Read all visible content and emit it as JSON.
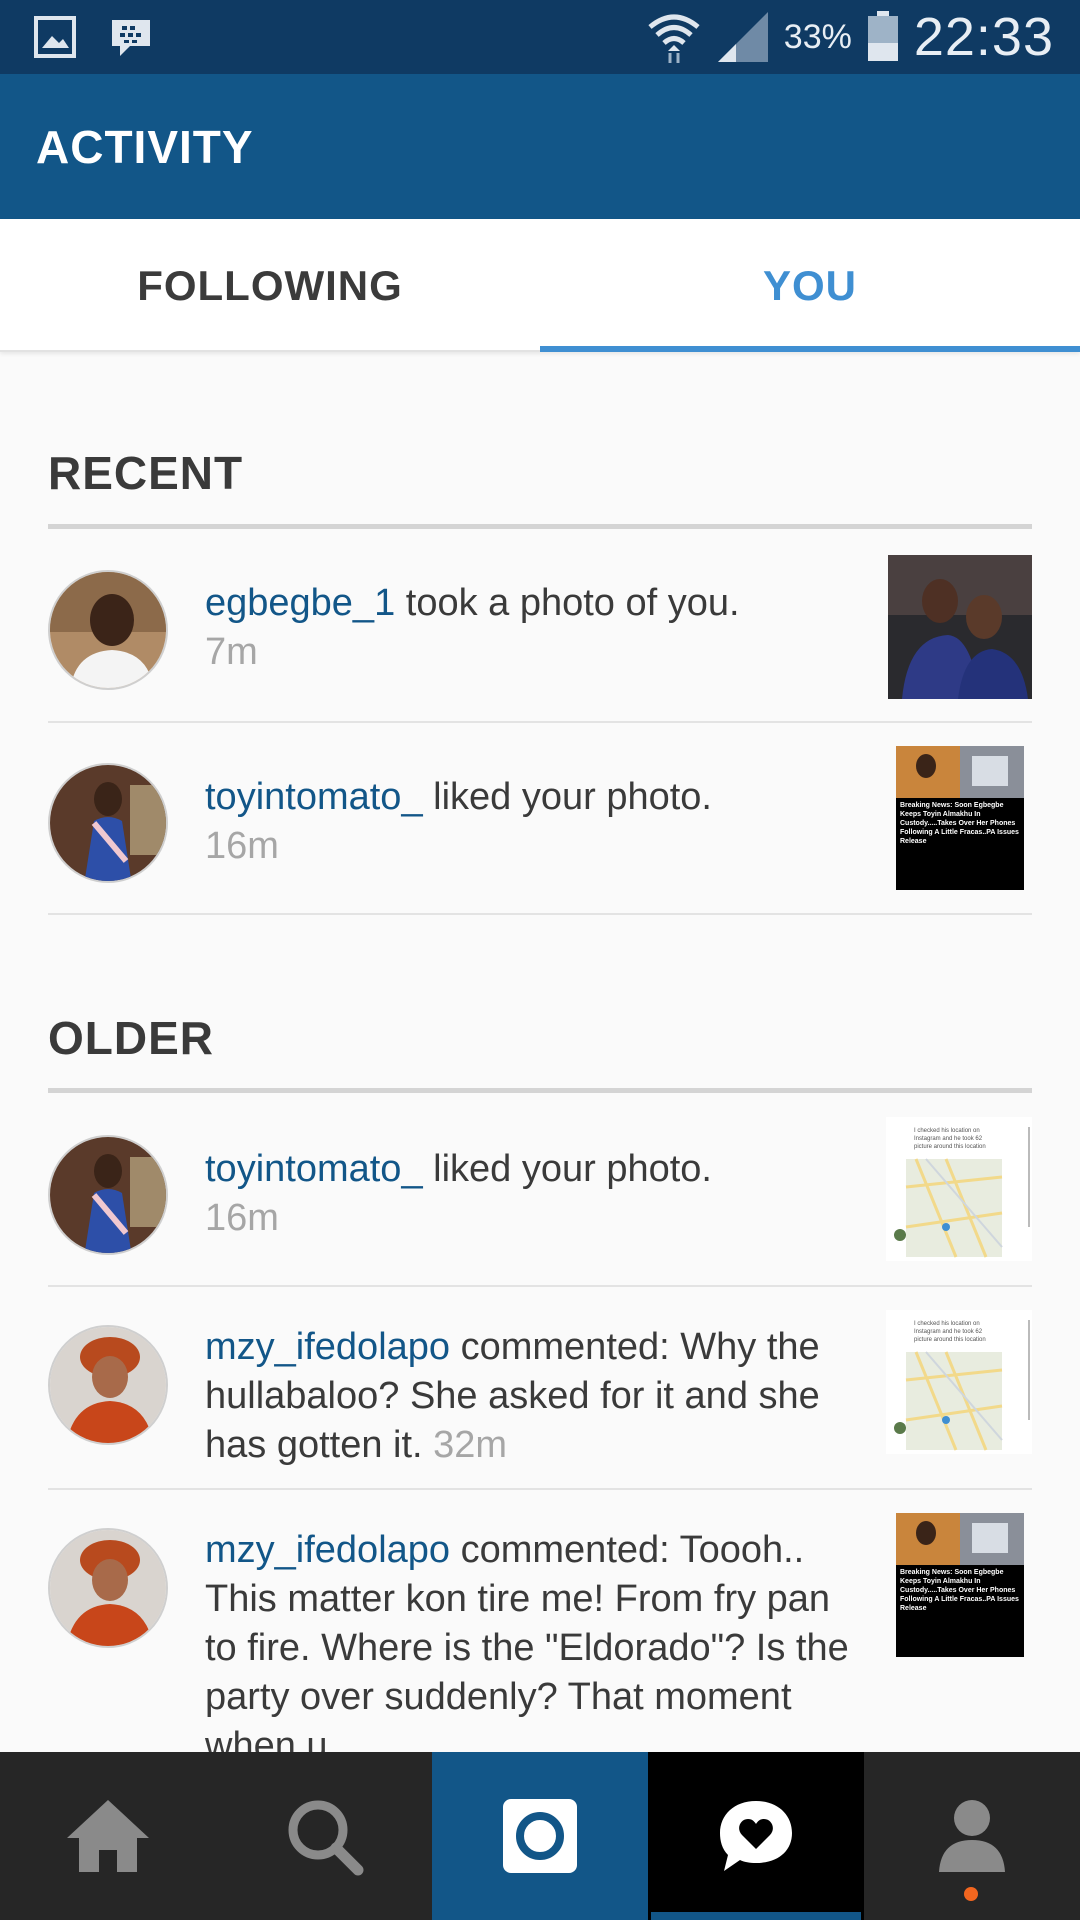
{
  "status_bar": {
    "battery_percent": "33%",
    "time": "22:33",
    "icons": [
      "gallery-icon",
      "bbm-icon",
      "wifi-icon",
      "signal-icon",
      "battery-icon"
    ]
  },
  "app_bar": {
    "title": "ACTIVITY"
  },
  "tabs": [
    {
      "label": "FOLLOWING",
      "active": false
    },
    {
      "label": "YOU",
      "active": true
    }
  ],
  "sections": {
    "recent": {
      "title": "RECENT",
      "items": [
        {
          "username": "egbegbe_1",
          "text": " took a photo of you.",
          "time": "7m"
        },
        {
          "username": "toyintomato_",
          "text": " liked your photo.",
          "time": "16m"
        }
      ]
    },
    "older": {
      "title": "OLDER",
      "items": [
        {
          "username": "toyintomato_",
          "text": " liked your photo.",
          "time": "16m"
        },
        {
          "username": "mzy_ifedolapo",
          "text": " commented: Why the hullabaloo? She asked for it and she has gotten it. ",
          "time": "32m"
        },
        {
          "username": "mzy_ifedolapo",
          "text": " commented: Toooh.. This matter kon tire me! From fry pan to fire. Where is the \"Eldorado\"? Is the party over suddenly? That moment when u",
          "time": ""
        }
      ]
    }
  },
  "thumbnails": {
    "news_headline": "Breaking News: Soon Egbegbe Keeps Toyin Almakhu In Custody.....Takes Over Her Phones Following A Little Fracas..PA Issues Release",
    "map_caption": "I checked his location on Instagram and he took 62 picture around this location"
  },
  "bottom_nav": {
    "items": [
      "home-icon",
      "search-icon",
      "camera-icon",
      "activity-icon",
      "profile-icon"
    ],
    "active": "activity-icon"
  },
  "colors": {
    "status_bar": "#0f3a63",
    "app_bar": "#125688",
    "accent": "#3f8fd2",
    "username": "#125688",
    "notification": "#f2661f"
  }
}
